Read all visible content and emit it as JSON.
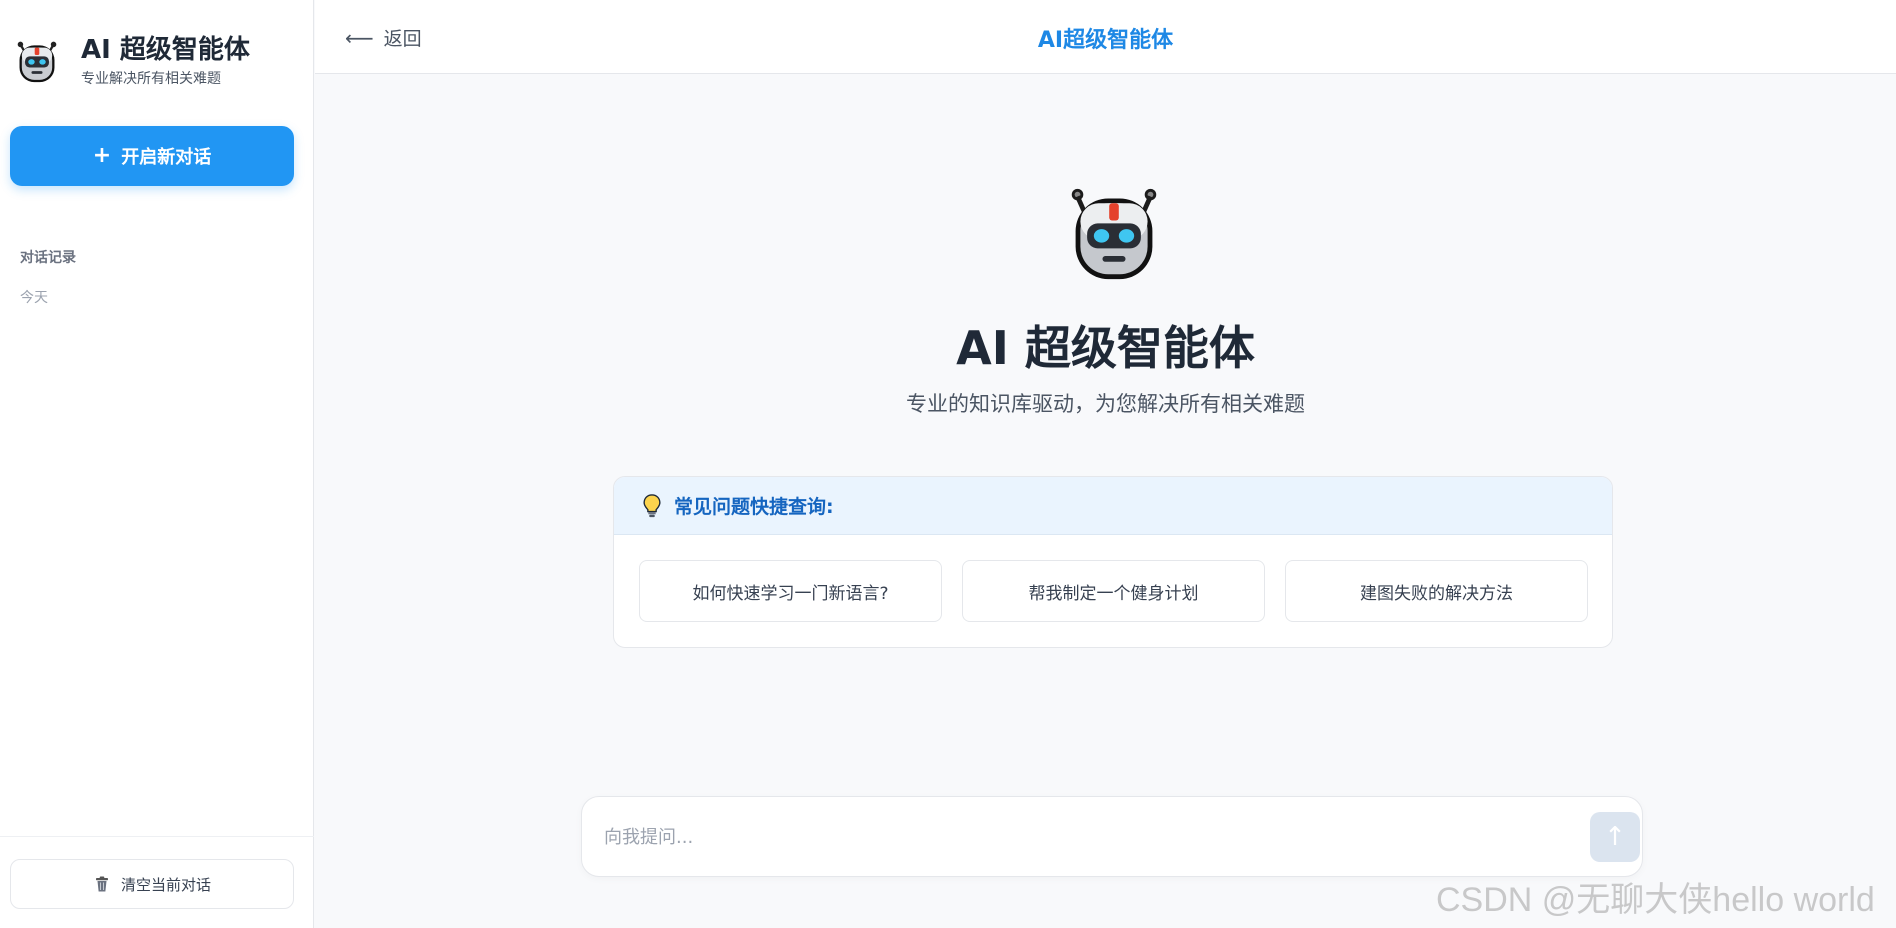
{
  "sidebar": {
    "brand_title": "AI 超级智能体",
    "brand_subtitle": "专业解决所有相关难题",
    "new_chat_label": "开启新对话",
    "history_title": "对话记录",
    "history_group_today": "今天",
    "clear_label": "清空当前对话"
  },
  "header": {
    "back_label": "返回",
    "title": "AI超级智能体"
  },
  "hero": {
    "title": "AI 超级智能体",
    "subtitle": "专业的知识库驱动，为您解决所有相关难题"
  },
  "faq": {
    "title": "常见问题快捷查询:",
    "items": [
      "如何快速学习一门新语言?",
      "帮我制定一个健身计划",
      "建图失败的解决方法"
    ]
  },
  "input": {
    "placeholder": "向我提问..."
  },
  "watermark": "CSDN @无聊大侠hello world",
  "icons": {
    "brand_avatar": "robot-icon",
    "new_chat": "plus-icon",
    "clear": "trash-icon",
    "back": "arrow-left-icon",
    "faq": "lightbulb-icon",
    "send": "arrow-up-icon"
  },
  "colors": {
    "accent": "#2196f3",
    "header_title": "#1e88e5",
    "faq_header_bg": "#eaf4fe",
    "faq_header_text": "#1565c0",
    "send_disabled": "#dbe4ef"
  }
}
